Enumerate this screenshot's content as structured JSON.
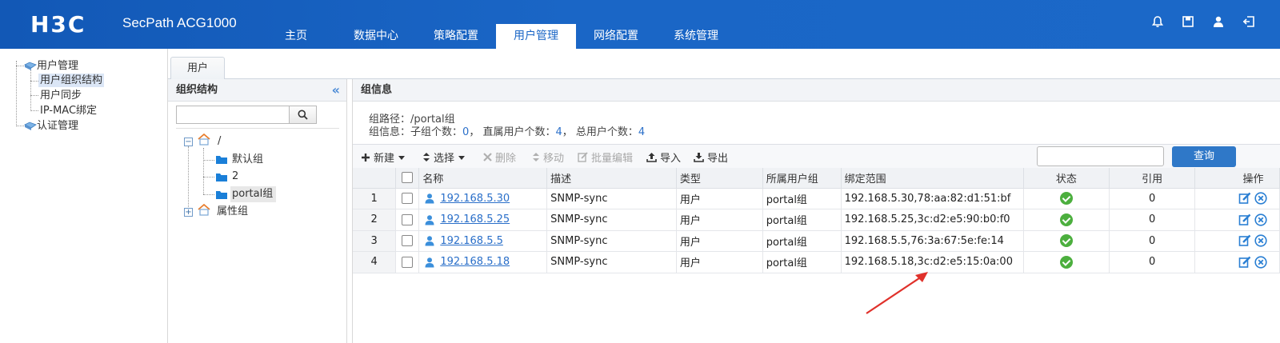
{
  "header": {
    "logo": "H3C",
    "product": "SecPath ACG1000",
    "nav": [
      "主页",
      "数据中心",
      "策略配置",
      "用户管理",
      "网络配置",
      "系统管理"
    ],
    "active_nav": "用户管理",
    "icons": [
      "bell-icon",
      "save-icon",
      "user-icon",
      "logout-icon"
    ]
  },
  "sidebar": {
    "items": [
      {
        "label": "用户管理",
        "level": 0
      },
      {
        "label": "用户组织结构",
        "level": 1,
        "selected": true
      },
      {
        "label": "用户同步",
        "level": 1
      },
      {
        "label": "IP-MAC绑定",
        "level": 1
      },
      {
        "label": "认证管理",
        "level": 0
      }
    ]
  },
  "tabs": [
    {
      "label": "用户"
    }
  ],
  "org": {
    "title": "组织结构",
    "search_placeholder": "",
    "tree": {
      "root": "/",
      "children": [
        "默认组",
        "2",
        "portal组"
      ],
      "selected": "portal组",
      "attr_group": "属性组"
    }
  },
  "info": {
    "title": "组信息",
    "path_label": "组路径：",
    "path_value": "/portal组",
    "info_label": "组信息：",
    "sub_label": "子组个数：",
    "sub_count": "0",
    "direct_label": "，  直属用户个数：",
    "direct_count": "4",
    "total_label": "，  总用户个数：",
    "total_count": "4"
  },
  "toolbar": {
    "new": "新建",
    "select": "选择",
    "delete": "删除",
    "move": "移动",
    "batch_edit": "批量编辑",
    "import": "导入",
    "export": "导出",
    "query": "查询"
  },
  "table": {
    "columns": [
      "",
      "",
      "名称",
      "描述",
      "类型",
      "所属用户组",
      "绑定范围",
      "状态",
      "引用",
      "操作"
    ],
    "rows": [
      {
        "idx": "1",
        "name": "192.168.5.30",
        "desc": "SNMP-sync",
        "type": "用户",
        "group": "portal组",
        "bind": "192.168.5.30,78:aa:82:d1:51:bf",
        "status": "ok",
        "ref": "0"
      },
      {
        "idx": "2",
        "name": "192.168.5.25",
        "desc": "SNMP-sync",
        "type": "用户",
        "group": "portal组",
        "bind": "192.168.5.25,3c:d2:e5:90:b0:f0",
        "status": "ok",
        "ref": "0"
      },
      {
        "idx": "3",
        "name": "192.168.5.5",
        "desc": "SNMP-sync",
        "type": "用户",
        "group": "portal组",
        "bind": "192.168.5.5,76:3a:67:5e:fe:14",
        "status": "ok",
        "ref": "0"
      },
      {
        "idx": "4",
        "name": "192.168.5.18",
        "desc": "SNMP-sync",
        "type": "用户",
        "group": "portal组",
        "bind": "192.168.5.18,3c:d2:e5:15:0a:00",
        "status": "ok",
        "ref": "0"
      }
    ]
  },
  "colors": {
    "brand": "#1a66c6",
    "link": "#2a6fc9",
    "ok": "#4caf3e",
    "annotation_arrow": "#e0312b"
  }
}
